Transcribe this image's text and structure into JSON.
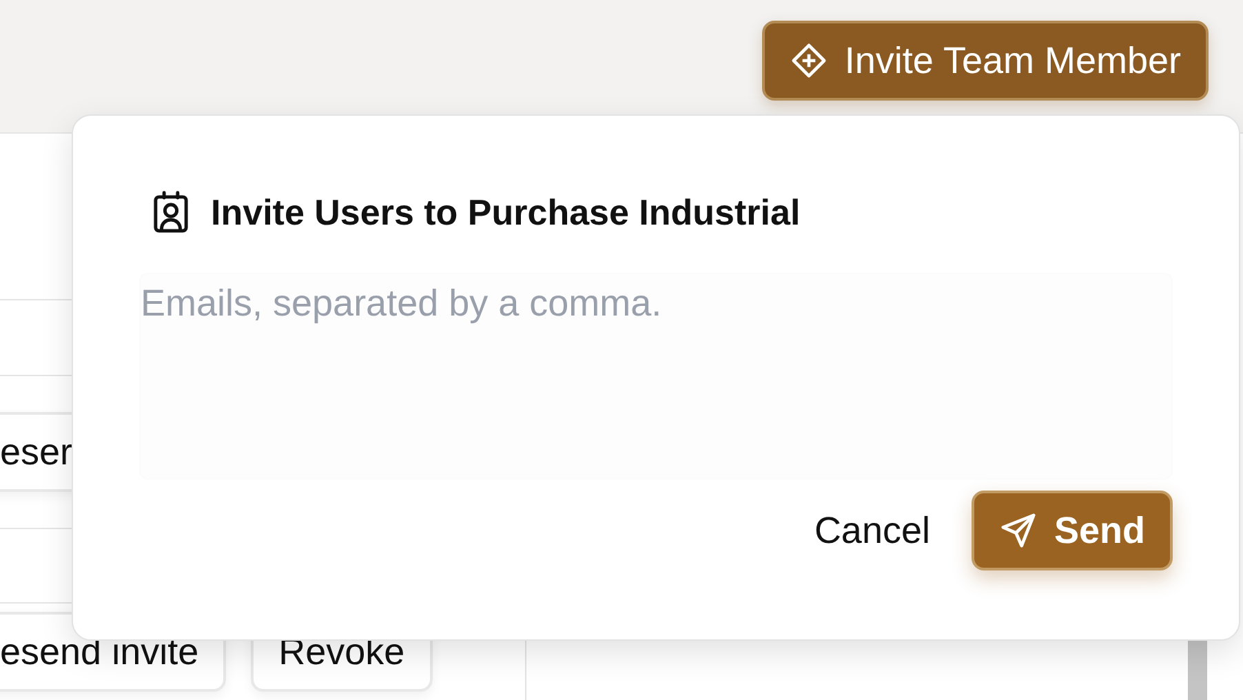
{
  "header": {
    "invite_button": "Invite Team Member"
  },
  "members": {
    "rows": [
      {
        "actions": [
          "eser"
        ]
      },
      {
        "actions": [
          "esend invite",
          "Revoke"
        ]
      }
    ]
  },
  "dialog": {
    "title": "Invite Users to Purchase Industrial",
    "emails": {
      "placeholder": "Emails, separated by a comma."
    },
    "cancel": "Cancel",
    "send": "Send"
  }
}
